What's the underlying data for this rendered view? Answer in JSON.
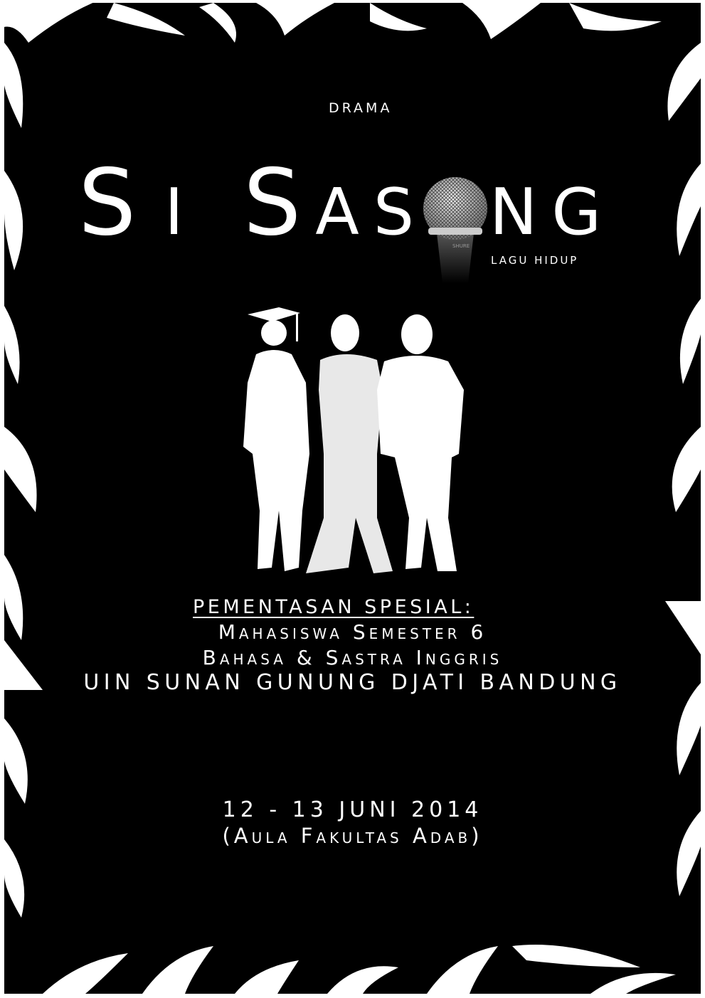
{
  "poster": {
    "category": "DRAMA",
    "title_parts": [
      "Si",
      "Sas",
      "ng"
    ],
    "subtitle": "LAGU HIDUP",
    "mic_brand": "SHURE",
    "heading": "PEMENTASAN SPESIAL:",
    "performers": "Mahasiswa Semester 6",
    "department": "Bahasa & Sastra Inggris",
    "university": "UIN SUNAN GUNUNG DJATI BANDUNG",
    "date": "12 - 13 JUNI 2014",
    "venue": "(Aula Fakultas Adab)"
  },
  "colors": {
    "background": "#000000",
    "foreground": "#ffffff",
    "frame": "#ffffff"
  }
}
